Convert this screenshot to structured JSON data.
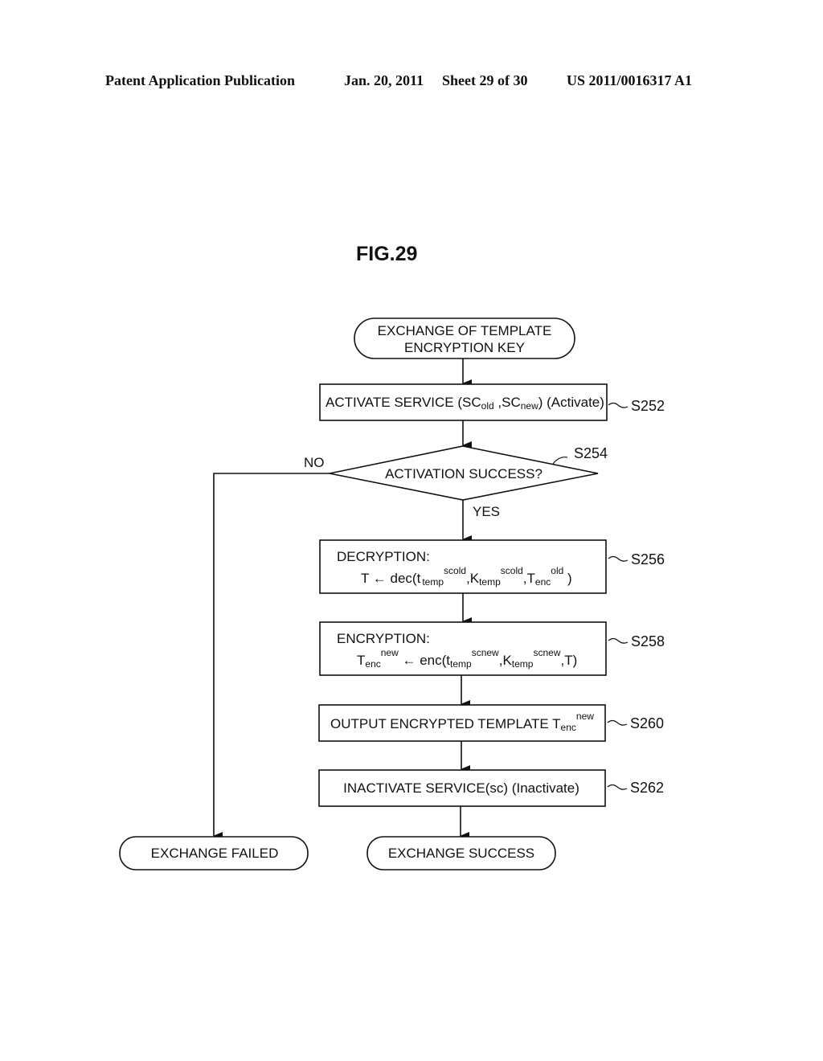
{
  "header": {
    "publication": "Patent Application Publication",
    "date": "Jan. 20, 2011",
    "sheet": "Sheet 29 of 30",
    "number": "US 2011/0016317 A1"
  },
  "figure_label": "FIG.29",
  "flowchart": {
    "start": {
      "line1": "EXCHANGE OF TEMPLATE",
      "line2": "ENCRYPTION KEY"
    },
    "s252": {
      "step": "S252",
      "text_a": "ACTIVATE SERVICE (SC",
      "sub_old": "old",
      "text_b": " ,SC",
      "sub_new": "new",
      "text_c": ") (Activate)"
    },
    "s254": {
      "step": "S254",
      "text": "ACTIVATION SUCCESS?",
      "no_label": "NO",
      "yes_label": "YES"
    },
    "s256": {
      "step": "S256",
      "title": "DECRYPTION:",
      "formula": {
        "lhs": "T ← dec(t",
        "sub1": "temp",
        "sup1": "scold",
        "mid1": ",K",
        "sub2": "temp",
        "sup2": "scold",
        "mid2": ",T",
        "sub3": "enc",
        "sup3": "old",
        "end": " )"
      }
    },
    "s258": {
      "step": "S258",
      "title": "ENCRYPTION:",
      "formula": {
        "lhs": "T",
        "sub0": "enc",
        "sup0": "new",
        "arrow": " ← enc(t",
        "sub1": "temp",
        "sup1": "scnew",
        "mid1": ",K",
        "sub2": "temp",
        "sup2": "scnew",
        "end": ",T)"
      }
    },
    "s260": {
      "step": "S260",
      "text": "OUTPUT ENCRYPTED TEMPLATE T",
      "sub": "enc",
      "sup": "new"
    },
    "s262": {
      "step": "S262",
      "text": "INACTIVATE SERVICE(sc) (Inactivate)"
    },
    "end_failed": "EXCHANGE FAILED",
    "end_success": "EXCHANGE SUCCESS"
  }
}
